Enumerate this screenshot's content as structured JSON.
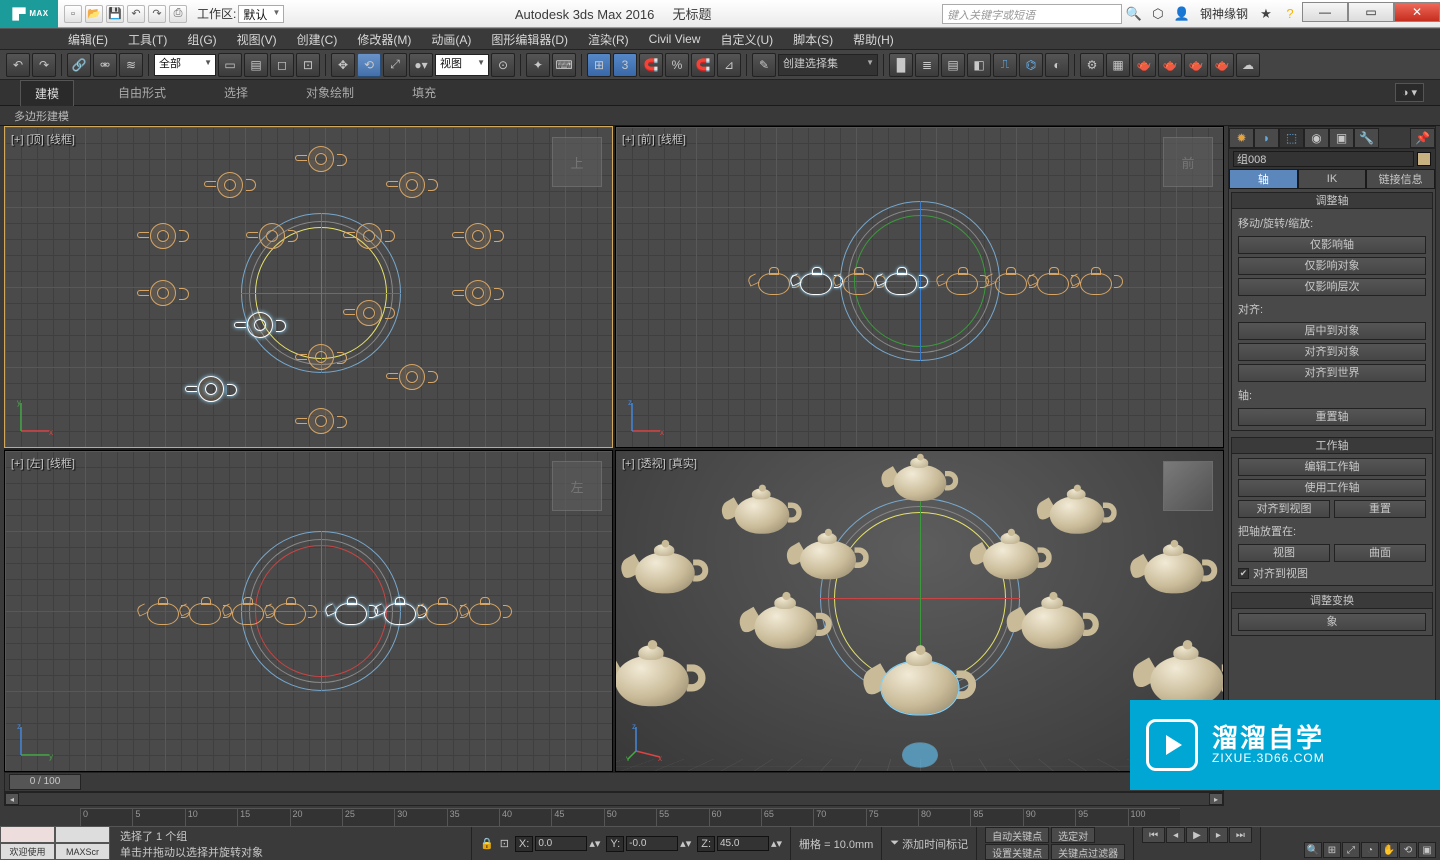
{
  "titlebar": {
    "workspace_label": "工作区:",
    "workspace_value": "默认",
    "app_title": "Autodesk 3ds Max 2016",
    "doc_title": "无标题",
    "search_placeholder": "键入关键字或短语",
    "username": "钢神缘钢"
  },
  "menu": [
    "编辑(E)",
    "工具(T)",
    "组(G)",
    "视图(V)",
    "创建(C)",
    "修改器(M)",
    "动画(A)",
    "图形编辑器(D)",
    "渲染(R)",
    "Civil View",
    "自定义(U)",
    "脚本(S)",
    "帮助(H)"
  ],
  "toolbar": {
    "filter": "全部",
    "viewport_select": "视图",
    "named_sel": "创建选择集",
    "snap3": "3"
  },
  "ribbon": {
    "tabs": [
      "建模",
      "自由形式",
      "选择",
      "对象绘制",
      "填充"
    ],
    "active": 0,
    "polybar": "多边形建模"
  },
  "viewports": {
    "tl": "[+] [顶] [线框]",
    "tr": "[+] [前] [线框]",
    "bl": "[+] [左] [线框]",
    "br": "[+] [透视] [真实]",
    "cube_top": "上",
    "cube_front": "前",
    "cube_left": "左"
  },
  "panel": {
    "object_name": "组008",
    "tabs3": {
      "a": "轴",
      "b": "IK",
      "c": "链接信息"
    },
    "roll1": {
      "title": "调整轴",
      "sub": "移动/旋转/缩放:",
      "b1": "仅影响轴",
      "b2": "仅影响对象",
      "b3": "仅影响层次",
      "sub2": "对齐:",
      "b4": "居中到对象",
      "b5": "对齐到对象",
      "b6": "对齐到世界",
      "sub3": "轴:",
      "b7": "重置轴"
    },
    "roll2": {
      "title": "工作轴",
      "b1": "编辑工作轴",
      "b2": "使用工作轴",
      "b3": "对齐到视图",
      "b4": "重置",
      "sub": "把轴放置在:",
      "b5": "视图",
      "b6": "曲面",
      "chk": "对齐到视图"
    },
    "roll3": {
      "title": "调整变换",
      "b1": "象"
    }
  },
  "timeline": {
    "slider": "0 / 100",
    "ticks": [
      "0",
      "5",
      "10",
      "15",
      "20",
      "25",
      "30",
      "35",
      "40",
      "45",
      "50",
      "55",
      "60",
      "65",
      "70",
      "75",
      "80",
      "85",
      "90",
      "95",
      "100"
    ]
  },
  "status": {
    "sel_msg": "选择了 1 个组",
    "hint": "单击并拖动以选择并旋转对象",
    "x": "0.0",
    "y": "-0.0",
    "z": "45.0",
    "grid": "栅格 = 10.0mm",
    "autokey": "自动关键点",
    "selset": "选定对",
    "setkey": "设置关键点",
    "keyfilter": "关键点过滤器",
    "addmarker": "添加时间标记"
  },
  "mini": {
    "a": "",
    "b": "",
    "c": "欢迎使用",
    "d": "MAXScr"
  },
  "watermark": {
    "t1": "溜溜自学",
    "t2": "ZIXUE.3D66.COM"
  }
}
